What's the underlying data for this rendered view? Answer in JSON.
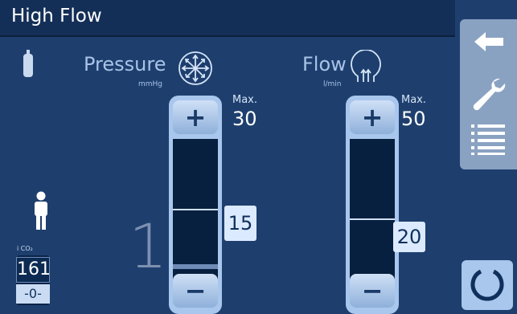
{
  "header": {
    "title": "High Flow"
  },
  "pressure": {
    "label": "Pressure",
    "unit": "mmHg",
    "max_label": "Max.",
    "max_value": "30",
    "set_value": "15",
    "level_fraction": 0.5
  },
  "flow": {
    "label": "Flow",
    "unit": "l/min",
    "max_label": "Max.",
    "max_value": "50",
    "set_value": "20",
    "level_fraction": 0.4
  },
  "patient": {
    "mode_number": "1"
  },
  "co2": {
    "label": "i CO₂",
    "value": "161",
    "sub": "-0-"
  },
  "sidebar": {
    "items": [
      "back-arrow-icon",
      "wrench-icon",
      "menu-list-icon"
    ]
  },
  "colors": {
    "background": "#1e3f6e",
    "titlebar": "#142f57",
    "accent": "#a9c6ec",
    "value_box": "#dbeaff"
  }
}
